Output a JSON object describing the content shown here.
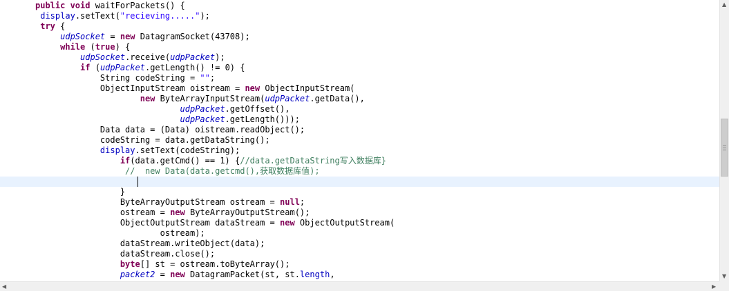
{
  "editor": {
    "lines": [
      [
        [
          "kw",
          "public "
        ],
        [
          "kw",
          "void "
        ],
        [
          "t",
          "waitForPackets() {"
        ]
      ],
      [
        [
          "t",
          " "
        ],
        [
          "fld",
          "display"
        ],
        [
          "t",
          ".setText("
        ],
        [
          "str",
          "\"recieving.....\""
        ],
        [
          "t",
          ");"
        ]
      ],
      [
        [
          "t",
          " "
        ],
        [
          "kw",
          "try "
        ],
        [
          "t",
          "{"
        ]
      ],
      [
        [
          "t",
          "     "
        ],
        [
          "fldi",
          "udpSocket"
        ],
        [
          "t",
          " = "
        ],
        [
          "kw",
          "new "
        ],
        [
          "t",
          "DatagramSocket(43708);"
        ]
      ],
      [
        [
          "t",
          "     "
        ],
        [
          "kw",
          "while "
        ],
        [
          "t",
          "("
        ],
        [
          "kw",
          "true"
        ],
        [
          "t",
          ") {"
        ]
      ],
      [
        [
          "t",
          "         "
        ],
        [
          "fldi",
          "udpSocket"
        ],
        [
          "t",
          ".receive("
        ],
        [
          "fldi",
          "udpPacket"
        ],
        [
          "t",
          ");"
        ]
      ],
      [
        [
          "t",
          "         "
        ],
        [
          "kw",
          "if "
        ],
        [
          "t",
          "("
        ],
        [
          "fldi",
          "udpPacket"
        ],
        [
          "t",
          ".getLength() != 0) {"
        ]
      ],
      [
        [
          "t",
          "             String codeString = "
        ],
        [
          "str",
          "\"\""
        ],
        [
          "t",
          ";"
        ]
      ],
      [
        [
          "t",
          "             ObjectInputStream oistream = "
        ],
        [
          "kw",
          "new "
        ],
        [
          "t",
          "ObjectInputStream("
        ]
      ],
      [
        [
          "t",
          "                     "
        ],
        [
          "kw",
          "new "
        ],
        [
          "t",
          "ByteArrayInputStream("
        ],
        [
          "fldi",
          "udpPacket"
        ],
        [
          "t",
          ".getData(),"
        ]
      ],
      [
        [
          "t",
          "                             "
        ],
        [
          "fldi",
          "udpPacket"
        ],
        [
          "t",
          ".getOffset(),"
        ]
      ],
      [
        [
          "t",
          "                             "
        ],
        [
          "fldi",
          "udpPacket"
        ],
        [
          "t",
          ".getLength()));"
        ]
      ],
      [
        [
          "t",
          "             Data data = (Data) oistream.readObject();"
        ]
      ],
      [
        [
          "t",
          "             codeString = data.getDataString();"
        ]
      ],
      [
        [
          "t",
          "             "
        ],
        [
          "fld",
          "display"
        ],
        [
          "t",
          ".setText(codeString);"
        ]
      ],
      [
        [
          "t",
          "                 "
        ],
        [
          "kw",
          "if"
        ],
        [
          "t",
          "(data.getCmd() == 1) {"
        ],
        [
          "cmt",
          "//data.getDataString写入数据库}"
        ]
      ],
      [
        [
          "t",
          "                  "
        ],
        [
          "cmt",
          "//  new Data(data.getcmd(),获取数据库值);"
        ]
      ],
      [
        [
          "t",
          ""
        ]
      ],
      [
        [
          "t",
          "                 }"
        ]
      ],
      [
        [
          "t",
          "                 ByteArrayOutputStream ostream = "
        ],
        [
          "kw",
          "null"
        ],
        [
          "t",
          ";"
        ]
      ],
      [
        [
          "t",
          "                 ostream = "
        ],
        [
          "kw",
          "new "
        ],
        [
          "t",
          "ByteArrayOutputStream();"
        ]
      ],
      [
        [
          "t",
          "                 ObjectOutputStream dataStream = "
        ],
        [
          "kw",
          "new "
        ],
        [
          "t",
          "ObjectOutputStream("
        ]
      ],
      [
        [
          "t",
          "                         ostream);"
        ]
      ],
      [
        [
          "t",
          "                 dataStream.writeObject(data);"
        ]
      ],
      [
        [
          "t",
          "                 dataStream.close();"
        ]
      ],
      [
        [
          "t",
          "                 "
        ],
        [
          "kw",
          "byte"
        ],
        [
          "t",
          "[] st = ostream.toByteArray();"
        ]
      ],
      [
        [
          "t",
          "                 "
        ],
        [
          "fldi",
          "packet2"
        ],
        [
          "t",
          " = "
        ],
        [
          "kw",
          "new "
        ],
        [
          "t",
          "DatagramPacket(st, st."
        ],
        [
          "fld",
          "length"
        ],
        [
          "t",
          ","
        ]
      ]
    ]
  },
  "icons": {
    "scroll_up": "▲",
    "scroll_down": "▼",
    "scroll_left": "◀",
    "scroll_right": "▶"
  }
}
